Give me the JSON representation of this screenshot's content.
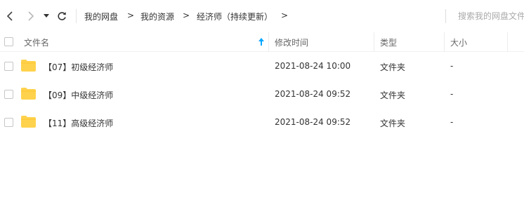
{
  "toolbar": {
    "back_icon": "chevron-left-icon",
    "forward_icon": "chevron-right-icon",
    "history_icon": "dropdown-triangle-icon",
    "refresh_icon": "refresh-icon",
    "breadcrumb": [
      "我的网盘",
      "我的资源",
      "经济师（持续更新）"
    ],
    "separator": ">",
    "search_placeholder": "搜索我的网盘文件"
  },
  "table": {
    "headers": {
      "name": "文件名",
      "modified": "修改时间",
      "type": "类型",
      "size": "大小"
    },
    "sort_icon": "sort-up-arrow-icon",
    "rows": [
      {
        "name": "【07】初级经济师",
        "modified": "2021-08-24 10:00",
        "type": "文件夹",
        "size": "-"
      },
      {
        "name": "【09】中级经济师",
        "modified": "2021-08-24 09:52",
        "type": "文件夹",
        "size": "-"
      },
      {
        "name": "【11】高级经济师",
        "modified": "2021-08-24 09:52",
        "type": "文件夹",
        "size": "-"
      }
    ]
  },
  "colors": {
    "folder": "#ffd24d",
    "sort_arrow": "#06a7ff",
    "text": "#333333",
    "muted": "#666666"
  }
}
